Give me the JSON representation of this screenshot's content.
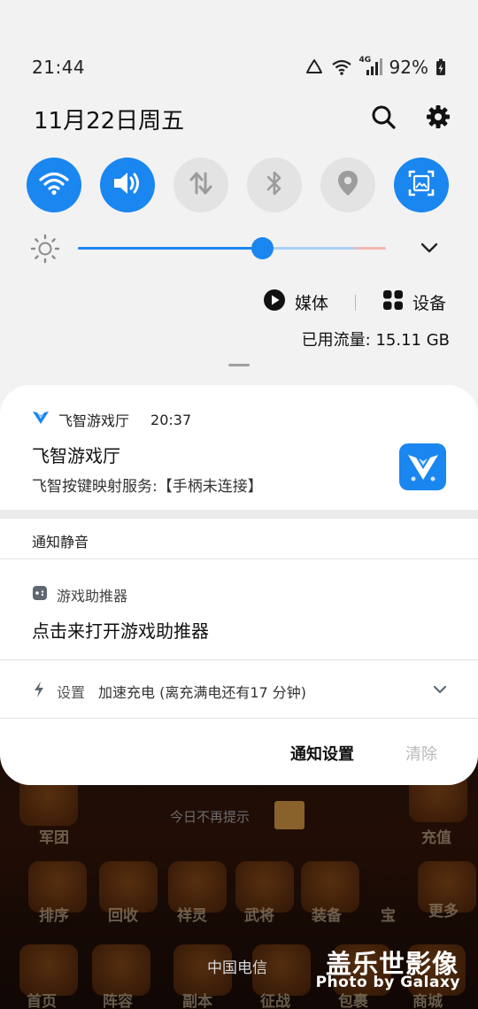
{
  "status_bar": {
    "time": "21:44",
    "battery_percent": "92%",
    "network_badge": "4G",
    "icons": [
      "recycle-icon",
      "wifi-signal-icon",
      "cellular-signal-icon",
      "battery-charging-icon"
    ]
  },
  "header": {
    "date": "11月22日周五",
    "icons": [
      "search-icon",
      "gear-icon"
    ]
  },
  "quick_tiles": [
    {
      "name": "wifi",
      "icon": "wifi-icon",
      "state": "on"
    },
    {
      "name": "sound",
      "icon": "volume-icon",
      "state": "on"
    },
    {
      "name": "mobile-data",
      "icon": "data-transfer-icon",
      "state": "off"
    },
    {
      "name": "bluetooth",
      "icon": "bluetooth-icon",
      "state": "off"
    },
    {
      "name": "location",
      "icon": "location-pin-icon",
      "state": "off"
    },
    {
      "name": "screenshot",
      "icon": "screen-capture-icon",
      "state": "on"
    }
  ],
  "brightness": {
    "level": 0.6
  },
  "media": {
    "media_label": "媒体",
    "devices_label": "设备"
  },
  "data_usage": "已用流量: 15.11 GB",
  "notifications": {
    "game_hall": {
      "app_name": "飞智游戏厅",
      "time": "20:37",
      "title": "飞智游戏厅",
      "text": "飞智按键映射服务:【手柄未连接】"
    },
    "silent_section_label": "通知静音",
    "game_assistant": {
      "app_name": "游戏助推器",
      "title": "点击来打开游戏助推器"
    },
    "charging": {
      "app_name": "设置",
      "text": "加速充电 (离充满电还有17 分钟)"
    },
    "actions": {
      "settings_label": "通知设置",
      "clear_label": "清除"
    }
  },
  "background": {
    "game_text": "今日不再提示",
    "carrier": "中国电信",
    "game_buttons": [
      "军团",
      "充值",
      "排序",
      "回收",
      "祥灵",
      "武将",
      "装备",
      "宝",
      "更多",
      "首页",
      "阵容",
      "副本",
      "征战",
      "包裹",
      "商城"
    ]
  },
  "watermark": {
    "title": "盖乐世影像",
    "subtitle": "Photo by Galaxy"
  },
  "colors": {
    "accent": "#1a86f0",
    "tile_off": "#e3e3e3",
    "card_bg": "#ffffff",
    "panel_bg": "#f2f2f2"
  }
}
